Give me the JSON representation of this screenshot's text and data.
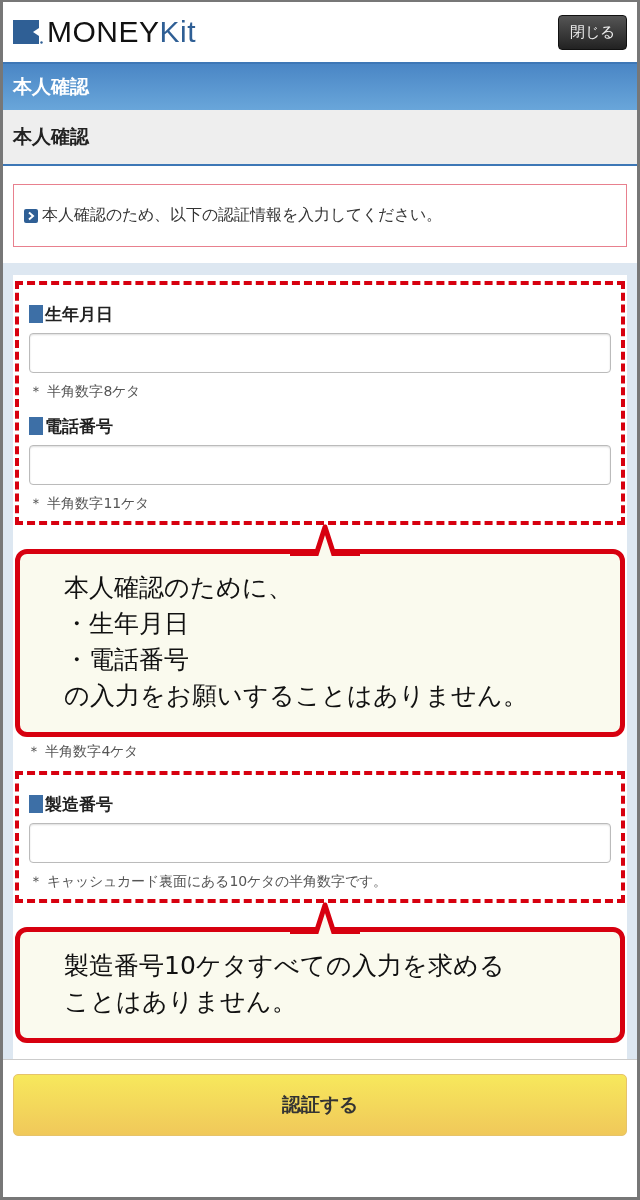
{
  "header": {
    "logo": {
      "main": "MONEY",
      "accent": "Kit"
    },
    "close_button": "閉じる"
  },
  "title_bar": "本人確認",
  "section_title": "本人確認",
  "notice": "本人確認のため、以下の認証情報を入力してください。",
  "form": [
    {
      "kind": "group",
      "fields": [
        {
          "label": "生年月日",
          "hint": "＊ 半角数字8ケタ"
        },
        {
          "label": "電話番号",
          "hint": "＊ 半角数字11ケタ"
        }
      ]
    },
    {
      "kind": "callout",
      "lines": [
        "本人確認のために、",
        "・生年月日",
        "・電話番号",
        "の入力をお願いすることはありません。"
      ]
    },
    {
      "kind": "hint",
      "text": "＊ 半角数字4ケタ"
    },
    {
      "kind": "group",
      "fields": [
        {
          "label": "製造番号",
          "hint": "＊ キャッシュカード裏面にある10ケタの半角数字です。"
        }
      ]
    },
    {
      "kind": "callout",
      "lines": [
        "製造番号10ケタすべての入力を求める",
        "ことはありません。"
      ]
    }
  ],
  "submit_button": "認証する"
}
